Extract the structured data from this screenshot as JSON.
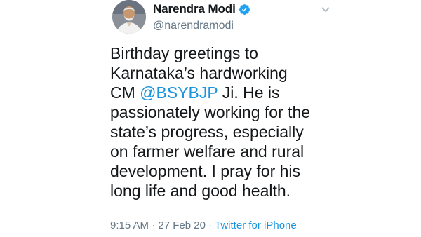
{
  "author": {
    "display_name": "Narendra Modi",
    "handle": "@narendramodi",
    "verified": true,
    "avatar_icon": "profile-photo-avatar"
  },
  "tweet": {
    "text_line1": "Birthday greetings to",
    "text_line2": "Karnataka’s hardworking",
    "text_line3_pre": "CM ",
    "mention": "@BSYBJP",
    "text_line3_post": " Ji. He is",
    "text_line4": "passionately working for the",
    "text_line5": "state’s progress, especially",
    "text_line6": "on farmer welfare and rural",
    "text_line7": "development. I pray for his",
    "text_line8": "long life and good health."
  },
  "meta": {
    "time": "9:15 AM",
    "separator1": " · ",
    "date": "27 Feb 20",
    "separator2": " · ",
    "source": "Twitter for iPhone"
  },
  "colors": {
    "link_blue": "#1b95e0",
    "text_dark": "#14171a",
    "text_gray": "#657786",
    "verified_blue": "#1da1f2"
  },
  "icons": {
    "verified": "verified-badge-icon",
    "caret": "chevron-down-icon"
  }
}
